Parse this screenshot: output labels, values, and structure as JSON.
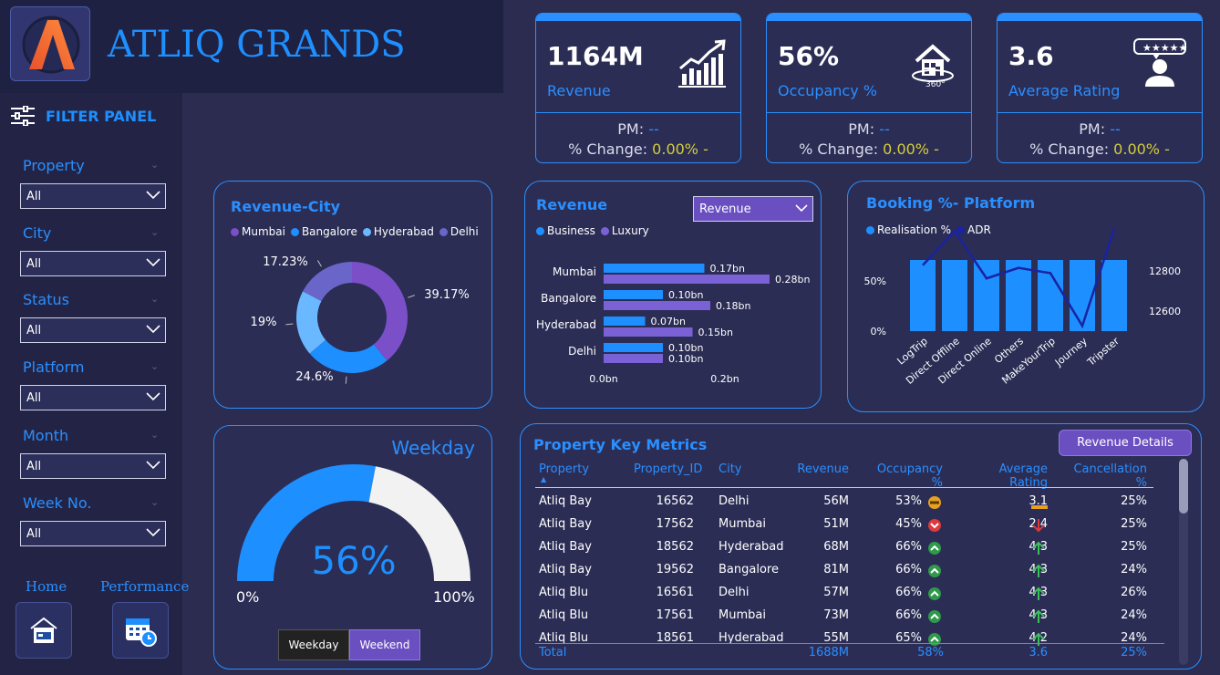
{
  "brand": {
    "title": "ATLIQ GRANDS"
  },
  "filter_panel": {
    "title": "FILTER PANEL"
  },
  "filters": [
    {
      "label": "Property",
      "value": "All"
    },
    {
      "label": "City",
      "value": "All"
    },
    {
      "label": "Status",
      "value": "All"
    },
    {
      "label": "Platform",
      "value": "All"
    },
    {
      "label": "Month",
      "value": "All"
    },
    {
      "label": "Week No.",
      "value": "All"
    }
  ],
  "nav": {
    "home": "Home",
    "performance": "Performance"
  },
  "kpis": [
    {
      "value": "1164M",
      "label": "Revenue",
      "pm_label": "PM:",
      "pm_value": "--",
      "change_label": "% Change:",
      "change_value": "0.00% -",
      "icon": "growth-chart-icon"
    },
    {
      "value": "56%",
      "label": "Occupancy %",
      "pm_label": "PM:",
      "pm_value": "--",
      "change_label": "% Change:",
      "change_value": "0.00% -",
      "icon": "house-360-icon"
    },
    {
      "value": "3.6",
      "label": "Average Rating",
      "pm_label": "PM:",
      "pm_value": "--",
      "change_label": "% Change:",
      "change_value": "0.00% -",
      "icon": "rating-user-icon"
    }
  ],
  "colors": {
    "accent": "#2a8fff",
    "purple": "#6a4fc1",
    "bg": "#2b2c4f",
    "yellow": "#d4cd3a"
  },
  "revenue_city": {
    "title": "Revenue-City",
    "legend": [
      "Mumbai",
      "Bangalore",
      "Hyderabad",
      "Delhi"
    ],
    "labels": [
      "39.17%",
      "24.6%",
      "19%",
      "17.23%"
    ]
  },
  "revenue_bar": {
    "title": "Revenue",
    "dropdown": "Revenue",
    "legend": [
      "Business",
      "Luxury"
    ],
    "axis_labels": [
      "0.0bn",
      "0.2bn"
    ]
  },
  "booking": {
    "title": "Booking %- Platform",
    "legend": [
      "Realisation %",
      "ADR"
    ],
    "left_ticks": [
      "50%",
      "0%"
    ],
    "right_ticks": [
      "12800",
      "12600"
    ]
  },
  "weekday": {
    "title": "Weekday",
    "value": "56%",
    "min": "0%",
    "max": "100%",
    "toggle_weekday": "Weekday",
    "toggle_weekend": "Weekend"
  },
  "property_metrics": {
    "title": "Property Key Metrics",
    "button": "Revenue Details",
    "columns": [
      "Property",
      "Property_ID",
      "City",
      "Revenue",
      "Occupancy %",
      "Average Rating",
      "Cancellation %"
    ],
    "rows": [
      {
        "property": "Atliq Bay",
        "id": "16562",
        "city": "Delhi",
        "revenue": "56M",
        "occ": "53%",
        "occ_icon": "neutral",
        "rating": "3.1",
        "rating_icon": "flat",
        "cancel": "25%"
      },
      {
        "property": "Atliq Bay",
        "id": "17562",
        "city": "Mumbai",
        "revenue": "51M",
        "occ": "45%",
        "occ_icon": "down",
        "rating": "2.4",
        "rating_icon": "down",
        "cancel": "25%"
      },
      {
        "property": "Atliq Bay",
        "id": "18562",
        "city": "Hyderabad",
        "revenue": "68M",
        "occ": "66%",
        "occ_icon": "up",
        "rating": "4.3",
        "rating_icon": "up",
        "cancel": "25%"
      },
      {
        "property": "Atliq Bay",
        "id": "19562",
        "city": "Bangalore",
        "revenue": "81M",
        "occ": "66%",
        "occ_icon": "up",
        "rating": "4.3",
        "rating_icon": "up",
        "cancel": "24%"
      },
      {
        "property": "Atliq Blu",
        "id": "16561",
        "city": "Delhi",
        "revenue": "57M",
        "occ": "66%",
        "occ_icon": "up",
        "rating": "4.3",
        "rating_icon": "up",
        "cancel": "26%"
      },
      {
        "property": "Atliq Blu",
        "id": "17561",
        "city": "Mumbai",
        "revenue": "73M",
        "occ": "66%",
        "occ_icon": "up",
        "rating": "4.3",
        "rating_icon": "up",
        "cancel": "24%"
      },
      {
        "property": "Atliq Blu",
        "id": "18561",
        "city": "Hyderabad",
        "revenue": "55M",
        "occ": "65%",
        "occ_icon": "up",
        "rating": "4.2",
        "rating_icon": "up",
        "cancel": "24%"
      }
    ],
    "total": {
      "label": "Total",
      "revenue": "1688M",
      "occ": "58%",
      "rating": "3.6",
      "cancel": "25%"
    }
  },
  "chart_data": [
    {
      "type": "pie",
      "title": "Revenue-City",
      "categories": [
        "Mumbai",
        "Bangalore",
        "Hyderabad",
        "Delhi"
      ],
      "values": [
        39.17,
        24.6,
        19,
        17.23
      ],
      "colors": [
        "#7a4fc8",
        "#1e8fff",
        "#6ab8ff",
        "#6a66c9"
      ],
      "legend": "top"
    },
    {
      "type": "bar",
      "title": "Revenue",
      "categories": [
        "Mumbai",
        "Bangalore",
        "Hyderabad",
        "Delhi"
      ],
      "series": [
        {
          "name": "Business",
          "values": [
            0.17,
            0.1,
            0.07,
            0.1
          ],
          "labels": [
            "0.17bn",
            "0.10bn",
            "0.07bn",
            "0.10bn"
          ]
        },
        {
          "name": "Luxury",
          "values": [
            0.28,
            0.18,
            0.15,
            0.1
          ],
          "labels": [
            "0.28bn",
            "0.18bn",
            "0.15bn",
            "0.10bn"
          ]
        }
      ],
      "xlim": [
        0,
        0.3
      ],
      "orientation": "horizontal"
    },
    {
      "type": "bar",
      "title": "Booking %- Platform",
      "categories": [
        "LogTrip",
        "Direct Offline",
        "Direct Online",
        "Others",
        "MakeYourTrip",
        "Journey",
        "Tripster"
      ],
      "series": [
        {
          "name": "Realisation %",
          "values": [
            70,
            70,
            70,
            70,
            70,
            70,
            70
          ]
        },
        {
          "name": "ADR",
          "values": [
            12650,
            12780,
            12600,
            12640,
            12620,
            12420,
            12790
          ]
        }
      ],
      "ylim_left": [
        0,
        70
      ],
      "ylim_right": [
        12400,
        12850
      ]
    }
  ]
}
